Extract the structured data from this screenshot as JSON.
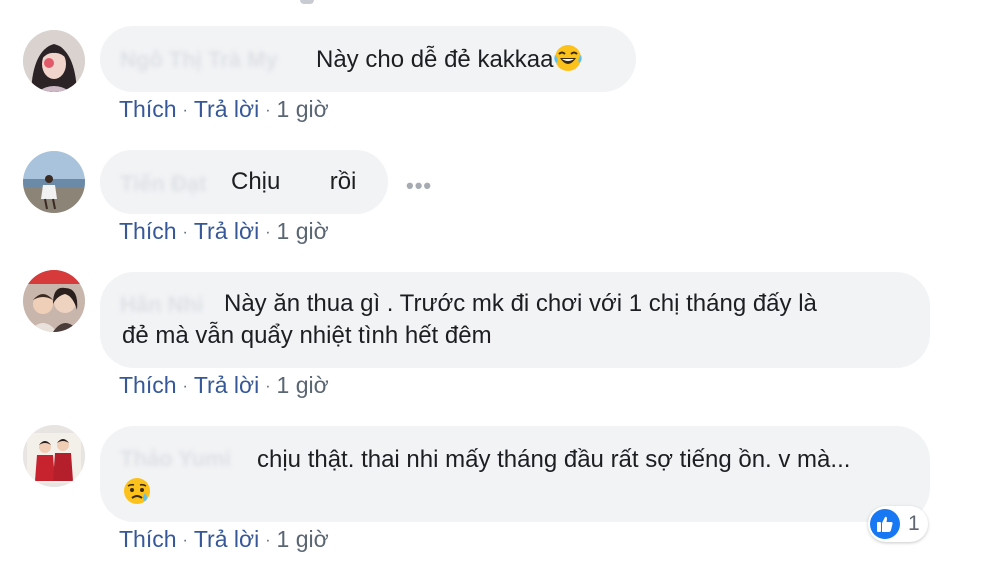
{
  "comments": [
    {
      "author": "Ngô Thị Trà My",
      "text": "Này cho dễ đẻ kakkaa",
      "emoji": "laughing-tears-icon",
      "like_label": "Thích",
      "reply_label": "Trả lời",
      "time": "1 giờ"
    },
    {
      "author": "Tiến Đạt",
      "text_before": "Chịu",
      "text_after": "rồi",
      "like_label": "Thích",
      "reply_label": "Trả lời",
      "time": "1 giờ",
      "more_label": "•••"
    },
    {
      "author": "Hân Nhi",
      "text": "Này ăn thua gì . Trước mk đi chơi với 1 chị tháng đấy là đẻ mà vẫn quẩy nhiệt tình hết đêm",
      "like_label": "Thích",
      "reply_label": "Trả lời",
      "time": "1 giờ"
    },
    {
      "author": "Thảo Yumi",
      "text": "chịu thật. thai nhi mấy tháng đầu rất sợ tiếng ồn. v mà...",
      "emoji": "sad-sweat-icon",
      "like_label": "Thích",
      "reply_label": "Trả lời",
      "time": "1 giờ",
      "reaction_count": "1",
      "reaction_icon": "like-thumb-icon"
    }
  ],
  "colors": {
    "link": "#365899",
    "bubble": "#f2f3f5",
    "like_blue": "#1877f2"
  }
}
